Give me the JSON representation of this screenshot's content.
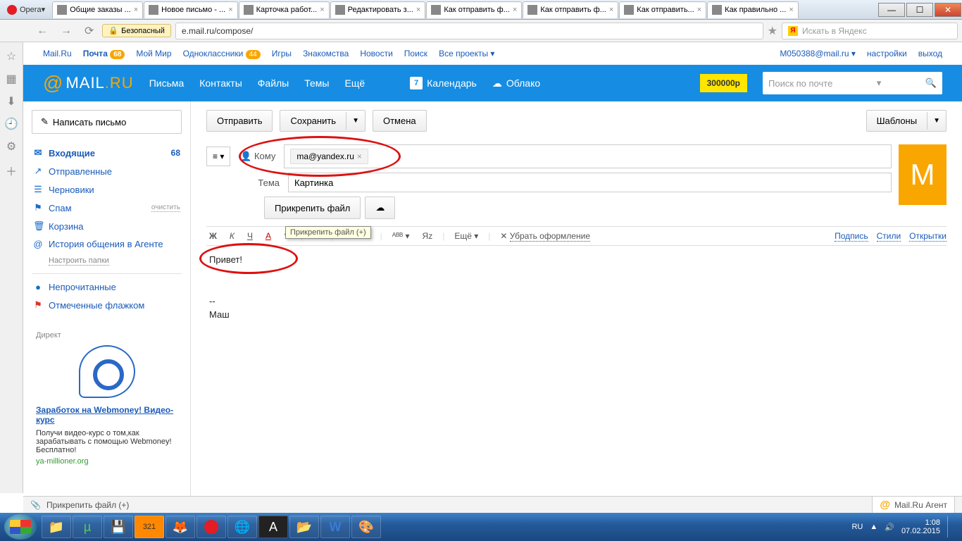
{
  "browser": {
    "name": "Opera",
    "tabs": [
      {
        "title": "Общие заказы ..."
      },
      {
        "title": "Новое письмо - ...",
        "active": true
      },
      {
        "title": "Карточка работ..."
      },
      {
        "title": "Редактировать з..."
      },
      {
        "title": "Как отправить ф..."
      },
      {
        "title": "Как отправить ф..."
      },
      {
        "title": "Как отправить..."
      },
      {
        "title": "Как правильно ..."
      }
    ],
    "safe_badge": "Безопасный",
    "url": "e.mail.ru/compose/",
    "search_placeholder": "Искать в Яндекс"
  },
  "mailru_links": {
    "left": [
      {
        "label": "Mail.Ru"
      },
      {
        "label": "Почта",
        "badge": "68",
        "bold": true
      },
      {
        "label": "Мой Мир"
      },
      {
        "label": "Одноклассники",
        "badge": "44"
      },
      {
        "label": "Игры"
      },
      {
        "label": "Знакомства"
      },
      {
        "label": "Новости"
      },
      {
        "label": "Поиск"
      },
      {
        "label": "Все проекты ▾"
      }
    ],
    "email": "M050388@mail.ru ▾",
    "settings": "настройки",
    "logout": "выход"
  },
  "header": {
    "logo_mail": "MAIL",
    "logo_ru": ".RU",
    "nav": [
      "Письма",
      "Контакты",
      "Файлы",
      "Темы",
      "Ещё"
    ],
    "calendar_day": "7",
    "calendar": "Календарь",
    "cloud": "Облако",
    "money": "300000р",
    "search_placeholder": "Поиск по почте"
  },
  "sidebar": {
    "compose": "Написать письмо",
    "folders": [
      {
        "icon": "✉",
        "label": "Входящие",
        "count": "68",
        "active": true
      },
      {
        "icon": "↗",
        "label": "Отправленные"
      },
      {
        "icon": "☰",
        "label": "Черновики"
      },
      {
        "icon": "⚑",
        "label": "Спам",
        "cleanup": "очистить"
      },
      {
        "icon": "🗑",
        "label": "Корзина"
      },
      {
        "icon": "@",
        "label": "История общения в Агенте"
      }
    ],
    "configure": "Настроить папки",
    "extras": [
      {
        "icon": "●",
        "label": "Непрочитанные"
      },
      {
        "icon": "⚑",
        "label": "Отмеченные флажком",
        "red": true
      }
    ],
    "ad": {
      "heading": "Директ",
      "title": "Заработок на Webmoney! Видео-курс",
      "desc": "Получи видео-курс о том,как зарабатывать с помощью Webmoney! Бесплатно!",
      "domain": "ya-millioner.org"
    }
  },
  "compose": {
    "actions": {
      "send": "Отправить",
      "save": "Сохранить",
      "cancel": "Отмена",
      "templates": "Шаблоны"
    },
    "to_label": "Кому",
    "to_value": "ma@yandex.ru",
    "subject_label": "Тема",
    "subject_value": "Картинка",
    "attach": "Прикрепить файл",
    "avatar_letter": "М",
    "tooltip": "Прикрепить файл (+)",
    "toolbar": {
      "bold": "Ж",
      "italic": "К",
      "underline": "Ч",
      "color": "А",
      "more": "Ещё",
      "remove_fmt": "Убрать оформление",
      "signature": "Подпись",
      "styles": "Стили",
      "cards": "Открытки"
    },
    "body_greeting": "Привет!",
    "body_sig_dash": "--",
    "body_sig_name": "Маш"
  },
  "status": {
    "attach": "Прикрепить файл (+)",
    "agent": "Mail.Ru Агент"
  },
  "taskbar": {
    "lang": "RU",
    "time": "1:08",
    "date": "07.02.2015"
  }
}
